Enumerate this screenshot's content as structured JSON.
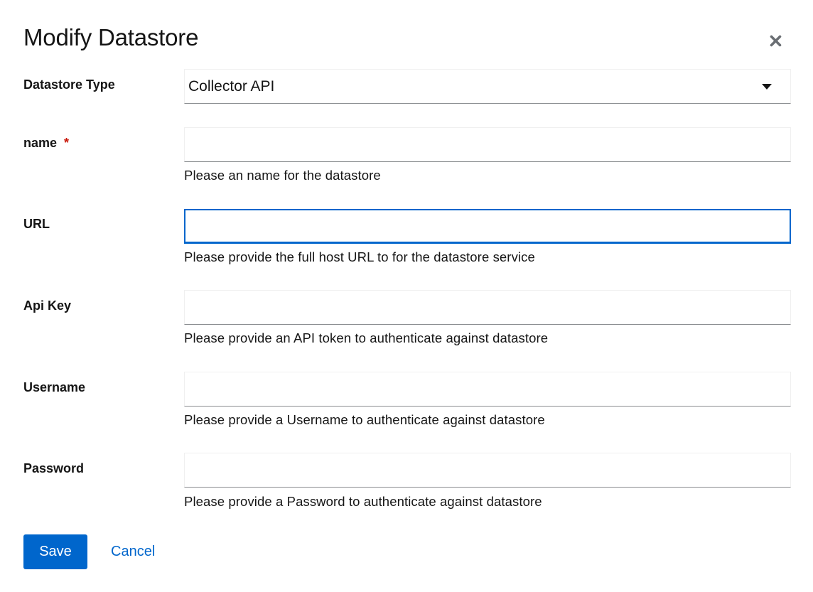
{
  "dialog": {
    "title": "Modify Datastore",
    "close_icon": "close-icon"
  },
  "form": {
    "datastore_type": {
      "label": "Datastore Type",
      "value": "Collector API",
      "icon": "caret-down-icon"
    },
    "name": {
      "label": "name",
      "required_marker": "*",
      "value": "",
      "helper": "Please an name for the datastore"
    },
    "url": {
      "label": "URL",
      "value": "",
      "helper": "Please provide the full host URL to for the datastore service"
    },
    "api_key": {
      "label": "Api Key",
      "value": "",
      "helper": "Please provide an API token to authenticate against datastore"
    },
    "username": {
      "label": "Username",
      "value": "",
      "helper": "Please provide a Username to authenticate against datastore"
    },
    "password": {
      "label": "Password",
      "value": "",
      "helper": "Please provide a Password to authenticate against datastore"
    }
  },
  "actions": {
    "save_label": "Save",
    "cancel_label": "Cancel"
  },
  "colors": {
    "primary": "#0066cc",
    "required": "#c9190b",
    "text": "#151515"
  }
}
